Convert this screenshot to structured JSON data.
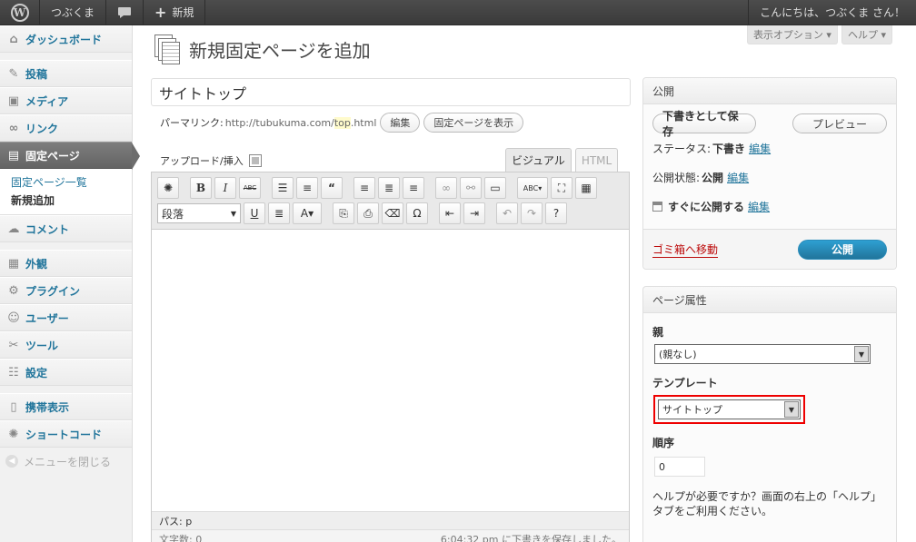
{
  "adminbar": {
    "logo": "W",
    "site_name": "つぶくま",
    "comments_icon": "speech-bubble-icon",
    "new_label": "新規",
    "greeting": "こんにちは、つぶくま さん！"
  },
  "sidebar": {
    "items": [
      {
        "label": "ダッシュボード",
        "icon": "home-icon"
      },
      {
        "label": "投稿",
        "icon": "pin-icon"
      },
      {
        "label": "メディア",
        "icon": "media-icon"
      },
      {
        "label": "リンク",
        "icon": "link-icon"
      },
      {
        "label": "固定ページ",
        "icon": "pages-icon"
      },
      {
        "label": "コメント",
        "icon": "comment-icon"
      },
      {
        "label": "外観",
        "icon": "appearance-icon"
      },
      {
        "label": "プラグイン",
        "icon": "plugin-icon"
      },
      {
        "label": "ユーザー",
        "icon": "users-icon"
      },
      {
        "label": "ツール",
        "icon": "tools-icon"
      },
      {
        "label": "設定",
        "icon": "settings-icon"
      },
      {
        "label": "携帯表示",
        "icon": "mobile-icon"
      },
      {
        "label": "ショートコード",
        "icon": "gear-icon"
      }
    ],
    "submenu": [
      "固定ページ一覧",
      "新規追加"
    ],
    "collapse_label": "メニューを閉じる"
  },
  "screen_options": {
    "options": "表示オプション ▾",
    "help": "ヘルプ ▾"
  },
  "page": {
    "title": "新規固定ページを追加"
  },
  "editor": {
    "title_value": "サイトトップ",
    "permalink_label": "パーマリンク:",
    "permalink_base": "http://tubukuma.com/",
    "permalink_slug": "top",
    "permalink_ext": ".html",
    "edit_btn": "編集",
    "view_btn": "固定ページを表示",
    "upload_label": "アップロード/挿入",
    "tab_visual": "ビジュアル",
    "tab_html": "HTML",
    "format_select": "段落",
    "path_label": "パス: p",
    "word_count": "文字数: 0",
    "autosave": "6:04:32 pm に下書きを保存しました。"
  },
  "publish": {
    "heading": "公開",
    "save_draft": "下書きとして保存",
    "preview": "プレビュー",
    "status_label": "ステータス:",
    "status_value": "下書き",
    "visibility_label": "公開状態:",
    "visibility_value": "公開",
    "schedule_label": "すぐに公開する",
    "edit_link": "編集",
    "trash": "ゴミ箱へ移動",
    "publish_btn": "公開"
  },
  "attributes": {
    "heading": "ページ属性",
    "parent_label": "親",
    "parent_value": "(親なし)",
    "template_label": "テンプレート",
    "template_value": "サイトトップ",
    "order_label": "順序",
    "order_value": "0",
    "help_text": "ヘルプが必要ですか？画面の右上の「ヘルプ」タブをご利用ください。"
  }
}
